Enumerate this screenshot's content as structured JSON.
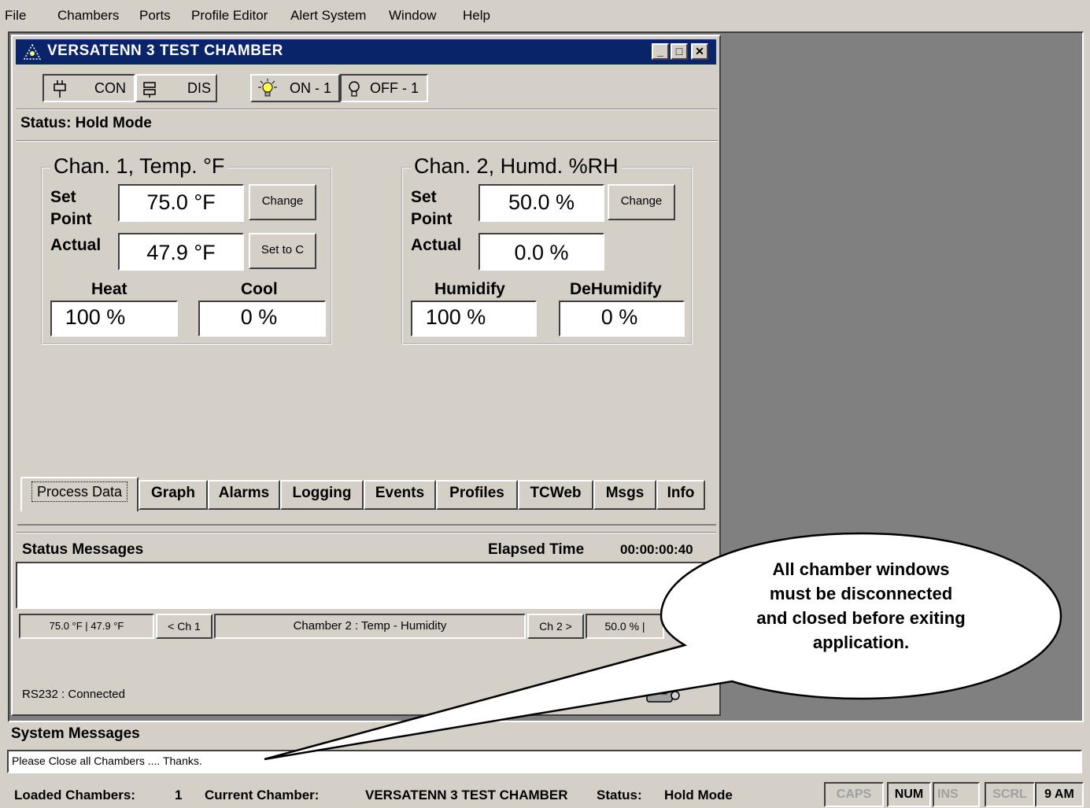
{
  "menu": [
    "File",
    "Chambers",
    "Ports",
    "Profile Editor",
    "Alert System",
    "Window",
    "Help"
  ],
  "window": {
    "title": "VERSATENN 3 TEST CHAMBER",
    "controls": {
      "minimize": "_",
      "maximize": "□",
      "close": "✕"
    }
  },
  "toolbar": {
    "connect_label": "CON",
    "disconnect_label": "DIS",
    "on_label": "ON - 1",
    "off_label": "OFF - 1"
  },
  "status_line": "Status:  Hold Mode",
  "channel1": {
    "title": "Chan. 1, Temp. °F",
    "set_point_label_1": "Set",
    "set_point_label_2": "Point",
    "set_point_value": "75.0 °F",
    "change_button": "Change",
    "actual_label": "Actual",
    "actual_value": "47.9 °F",
    "set_to_c_button": "Set to C",
    "heat_label": "Heat",
    "heat_value": "100 %",
    "cool_label": "Cool",
    "cool_value": "0 %"
  },
  "channel2": {
    "title": "Chan. 2, Humd. %RH",
    "set_point_label_1": "Set",
    "set_point_label_2": "Point",
    "set_point_value": "50.0 %",
    "change_button": "Change",
    "actual_label": "Actual",
    "actual_value": "0.0 %",
    "humidify_label": "Humidify",
    "humidify_value": "100 %",
    "dehumidify_label": "DeHumidify",
    "dehumidify_value": "0 %"
  },
  "tabs": [
    "Process Data",
    "Graph",
    "Alarms",
    "Logging",
    "Events",
    "Profiles",
    "TCWeb",
    "Msgs",
    "Info"
  ],
  "status_messages": {
    "title": "Status Messages",
    "elapsed_label": "Elapsed Time",
    "elapsed_value": "00:00:00:40"
  },
  "chamber_bar": {
    "ch1_values": "75.0 °F  |  47.9 °F",
    "ch1_nav": "< Ch 1",
    "chamber_name": "Chamber 2 : Temp - Humidity",
    "ch2_nav": "Ch 2 >",
    "ch2_values": "50.0 %  |"
  },
  "port_status": "RS232 : Connected",
  "system_messages": {
    "title": "System Messages",
    "text": "Please Close all Chambers .... Thanks."
  },
  "callout": {
    "line1": "All chamber windows",
    "line2": "must be disconnected",
    "line3": "and closed before exiting",
    "line4": "application."
  },
  "statusbar": {
    "loaded_label": "Loaded Chambers:",
    "loaded_value": "1",
    "current_label": "Current Chamber:",
    "current_value": "VERSATENN 3 TEST CHAMBER",
    "status_label": "Status:",
    "status_value": "Hold Mode",
    "caps": "CAPS",
    "num": "NUM",
    "ins": "INS",
    "scrl": "SCRL",
    "time": "9 AM"
  }
}
